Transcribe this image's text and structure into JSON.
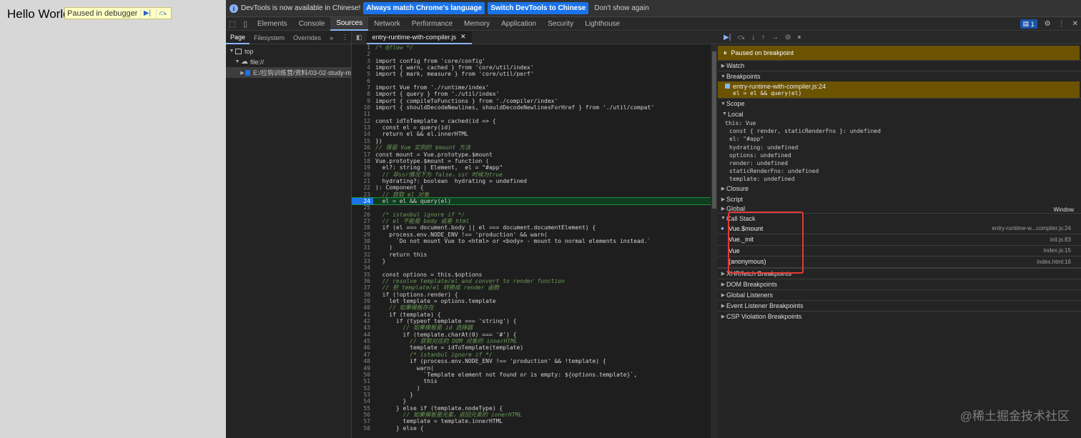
{
  "page": {
    "hello": "Hello World",
    "debugger_badge": "Paused in debugger"
  },
  "infobar": {
    "message": "DevTools is now available in Chinese!",
    "btn_match": "Always match Chrome's language",
    "btn_switch": "Switch DevTools to Chinese",
    "btn_dont": "Don't show again"
  },
  "tabs": [
    "Elements",
    "Console",
    "Sources",
    "Network",
    "Performance",
    "Memory",
    "Application",
    "Security",
    "Lighthouse"
  ],
  "active_tab": "Sources",
  "issues_count": "1",
  "nav": {
    "tabs": [
      "Page",
      "Filesystem",
      "Overrides"
    ],
    "tree": {
      "top": "top",
      "file": "file://",
      "folder": "E:/拉钩训练营/资料/03-02-study-m"
    }
  },
  "editor": {
    "file_tab": "entry-runtime-with-compiler.js",
    "lines": [
      {
        "n": "1",
        "t": "/* @flow */"
      },
      {
        "n": "2",
        "t": ""
      },
      {
        "n": "3",
        "t": "import config from 'core/config'"
      },
      {
        "n": "4",
        "t": "import { warn, cached } from 'core/util/index'"
      },
      {
        "n": "5",
        "t": "import { mark, measure } from 'core/util/perf'"
      },
      {
        "n": "6",
        "t": ""
      },
      {
        "n": "7",
        "t": "import Vue from './runtime/index'"
      },
      {
        "n": "8",
        "t": "import { query } from './util/index'"
      },
      {
        "n": "9",
        "t": "import { compileToFunctions } from './compiler/index'"
      },
      {
        "n": "10",
        "t": "import { shouldDecodeNewlines, shouldDecodeNewlinesForHref } from './util/compat'"
      },
      {
        "n": "11",
        "t": ""
      },
      {
        "n": "12",
        "t": "const idToTemplate = cached(id => {"
      },
      {
        "n": "13",
        "t": "  const el = query(id)"
      },
      {
        "n": "14",
        "t": "  return el && el.innerHTML"
      },
      {
        "n": "15",
        "t": "})"
      },
      {
        "n": "16",
        "t": "// 保留 Vue 实例的 $mount 方法"
      },
      {
        "n": "17",
        "t": "const mount = Vue.prototype.$mount"
      },
      {
        "n": "18",
        "t": "Vue.prototype.$mount = function ("
      },
      {
        "n": "19",
        "t": "  el?: string | Element,  el = \"#app\""
      },
      {
        "n": "20",
        "t": "  // 非ssr情况下为 false，ssr 时候为true"
      },
      {
        "n": "21",
        "t": "  hydrating?: boolean  hydrating = undefined"
      },
      {
        "n": "22",
        "t": "): Component {"
      },
      {
        "n": "23",
        "t": "  // 获取 el 对象"
      },
      {
        "n": "24",
        "t": "  el = el && query(el)"
      },
      {
        "n": "25",
        "t": ""
      },
      {
        "n": "26",
        "t": "  /* istanbul ignore if */"
      },
      {
        "n": "27",
        "t": "  // el 不能是 body 或者 html"
      },
      {
        "n": "28",
        "t": "  if (el === document.body || el === document.documentElement) {"
      },
      {
        "n": "29",
        "t": "    process.env.NODE_ENV !== 'production' && warn("
      },
      {
        "n": "30",
        "t": "      `Do not mount Vue to <html> or <body> - mount to normal elements instead.`"
      },
      {
        "n": "31",
        "t": "    )"
      },
      {
        "n": "32",
        "t": "    return this"
      },
      {
        "n": "33",
        "t": "  }"
      },
      {
        "n": "34",
        "t": ""
      },
      {
        "n": "35",
        "t": "  const options = this.$options"
      },
      {
        "n": "36",
        "t": "  // resolve template/el and convert to render function"
      },
      {
        "n": "37",
        "t": "  // 把 template/el 转换成 render 函数"
      },
      {
        "n": "38",
        "t": "  if (!options.render) {"
      },
      {
        "n": "39",
        "t": "    let template = options.template"
      },
      {
        "n": "40",
        "t": "    // 如果模板存在"
      },
      {
        "n": "41",
        "t": "    if (template) {"
      },
      {
        "n": "42",
        "t": "      if (typeof template === 'string') {"
      },
      {
        "n": "43",
        "t": "        // 如果模板是 id 选择器"
      },
      {
        "n": "44",
        "t": "        if (template.charAt(0) === '#') {"
      },
      {
        "n": "45",
        "t": "          // 获取对应的 DOM 对象的 innerHTML"
      },
      {
        "n": "46",
        "t": "          template = idToTemplate(template)"
      },
      {
        "n": "47",
        "t": "          /* istanbul ignore if */"
      },
      {
        "n": "48",
        "t": "          if (process.env.NODE_ENV !== 'production' && !template) {"
      },
      {
        "n": "49",
        "t": "            warn("
      },
      {
        "n": "50",
        "t": "              `Template element not found or is empty: ${options.template}`,"
      },
      {
        "n": "51",
        "t": "              this"
      },
      {
        "n": "52",
        "t": "            )"
      },
      {
        "n": "53",
        "t": "          }"
      },
      {
        "n": "54",
        "t": "        }"
      },
      {
        "n": "55",
        "t": "      } else if (template.nodeType) {"
      },
      {
        "n": "56",
        "t": "        // 如果模板是元素，返回元素的 innerHTML"
      },
      {
        "n": "57",
        "t": "        template = template.innerHTML"
      },
      {
        "n": "58",
        "t": "      } else {"
      }
    ],
    "breakpoint_line": "24"
  },
  "debugger": {
    "paused_msg": "Paused on breakpoint",
    "watch": "Watch",
    "breakpoints": "Breakpoints",
    "bp_file": "entry-runtime-with-compiler.js:24",
    "bp_code": "el = el && query(el)",
    "scope": "Scope",
    "local": "Local",
    "scope_vars": [
      "this: Vue",
      "const { render, staticRenderFns }: undefined",
      "el: \"#app\"",
      "hydrating: undefined",
      "options: undefined",
      "render: undefined",
      "staticRenderFns: undefined",
      "template: undefined"
    ],
    "closure": "Closure",
    "script": "Script",
    "global": "Global",
    "global_value": "Window",
    "call_stack": "Call Stack",
    "frames": [
      {
        "fn": "Vue.$mount",
        "loc": "entry-runtime-w...compiler.js:24"
      },
      {
        "fn": "Vue._init",
        "loc": "init.js:83"
      },
      {
        "fn": "Vue",
        "loc": "index.js:15"
      },
      {
        "fn": "(anonymous)",
        "loc": "index.html:16"
      }
    ],
    "more_sections": [
      "XHR/fetch Breakpoints",
      "DOM Breakpoints",
      "Global Listeners",
      "Event Listener Breakpoints",
      "CSP Violation Breakpoints"
    ]
  },
  "watermark": "@稀土掘金技术社区",
  "colors": {
    "accent": "#1a73e8",
    "highlight": "#e53935",
    "paused_bg": "#6b5300"
  }
}
